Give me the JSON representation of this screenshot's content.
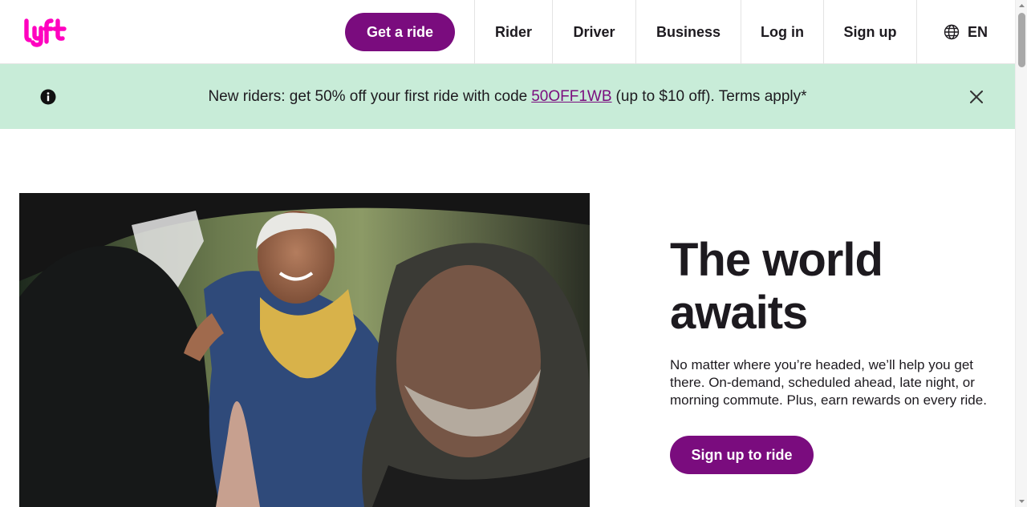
{
  "header": {
    "logo_text": "lyft",
    "cta_label": "Get a ride",
    "nav": [
      {
        "label": "Rider"
      },
      {
        "label": "Driver"
      },
      {
        "label": "Business"
      },
      {
        "label": "Log in"
      },
      {
        "label": "Sign up"
      }
    ],
    "language": {
      "label": "EN",
      "icon": "globe-icon"
    }
  },
  "banner": {
    "icon": "info-icon",
    "text_before": "New riders: get 50% off your first ride with code",
    "code": "50OFF1WB",
    "text_after": "(up to $10 off). Terms apply*",
    "close_icon": "close-icon"
  },
  "hero": {
    "title_line1": "The world",
    "title_line2": "awaits",
    "body": "No matter where you’re headed, we’ll help you get there. On-demand, scheduled ahead, late night, or morning commute. Plus, earn rewards on every ride.",
    "button_label": "Sign up to ride"
  },
  "colors": {
    "brand_pink": "#ff00bf",
    "brand_purple": "#7a0c7e",
    "banner_bg": "#c8ecd8",
    "text": "#1d1a1f"
  }
}
